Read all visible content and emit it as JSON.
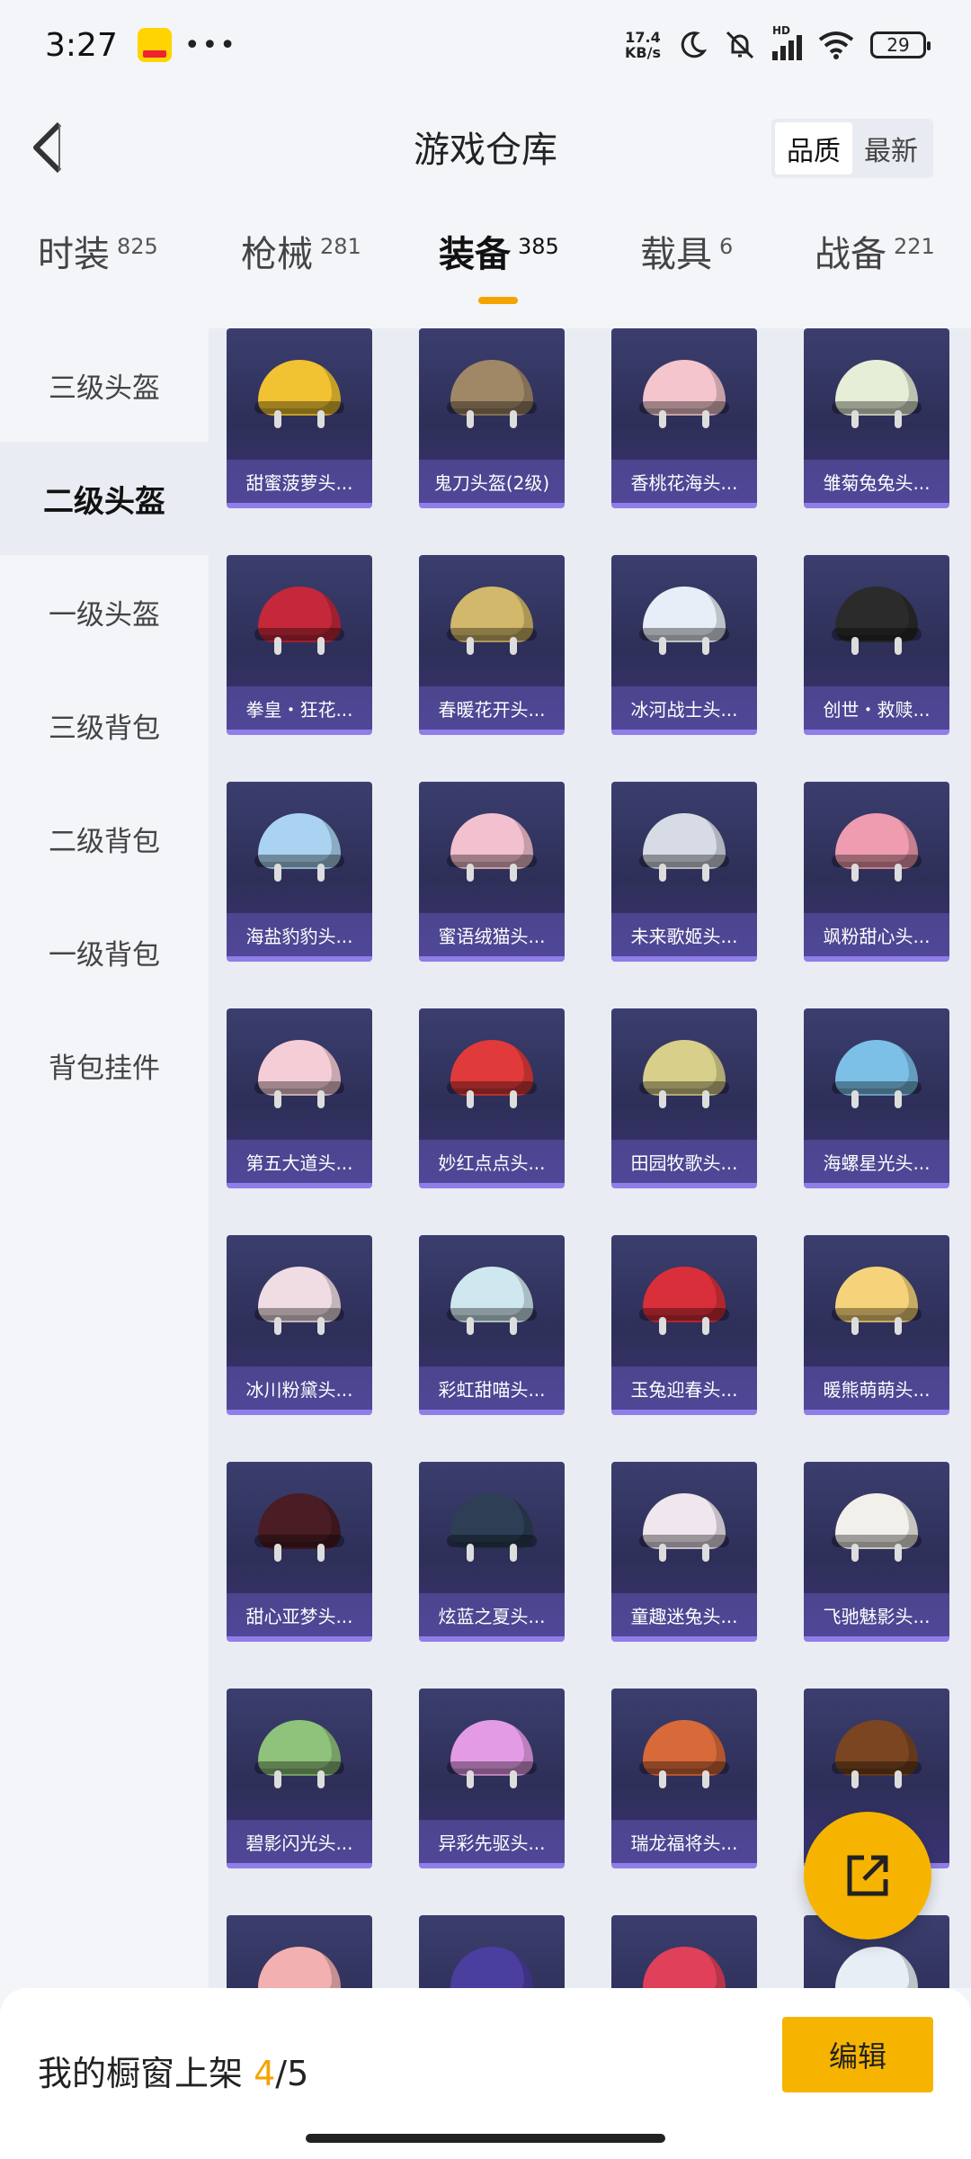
{
  "status_bar": {
    "time": "3:27",
    "dots": "•••",
    "net_speed_value": "17.4",
    "net_speed_unit": "KB/s",
    "network": "HD",
    "battery": "29"
  },
  "header": {
    "title": "游戏仓库",
    "sort_options": [
      "品质",
      "最新"
    ],
    "sort_selected": "品质"
  },
  "tabs": [
    {
      "label": "时装",
      "count": "825"
    },
    {
      "label": "枪械",
      "count": "281"
    },
    {
      "label": "装备",
      "count": "385",
      "active": true
    },
    {
      "label": "载具",
      "count": "6"
    },
    {
      "label": "战备",
      "count": "221"
    }
  ],
  "sidebar": [
    {
      "label": "三级头盔"
    },
    {
      "label": "二级头盔",
      "active": true
    },
    {
      "label": "一级头盔"
    },
    {
      "label": "三级背包"
    },
    {
      "label": "二级背包"
    },
    {
      "label": "一级背包"
    },
    {
      "label": "背包挂件"
    }
  ],
  "items": [
    {
      "name": "甜蜜菠萝头...",
      "color": "#f1c232"
    },
    {
      "name": "鬼刀头盔(2级)",
      "color": "#a08867"
    },
    {
      "name": "香桃花海头...",
      "color": "#f4c5cc"
    },
    {
      "name": "雏菊兔兔头...",
      "color": "#e6eed8"
    },
    {
      "name": "拳皇・狂花...",
      "color": "#c5283a"
    },
    {
      "name": "春暖花开头...",
      "color": "#d2b86a"
    },
    {
      "name": "冰河战士头...",
      "color": "#e8eef7"
    },
    {
      "name": "创世・救赎...",
      "color": "#2b2b2b"
    },
    {
      "name": "海盐豹豹头...",
      "color": "#a9d3f0"
    },
    {
      "name": "蜜语绒猫头...",
      "color": "#f3c0cf"
    },
    {
      "name": "未来歌姬头...",
      "color": "#d6dbe6"
    },
    {
      "name": "飒粉甜心头...",
      "color": "#ef9bb0"
    },
    {
      "name": "第五大道头...",
      "color": "#f5cdd6"
    },
    {
      "name": "妙红点点头...",
      "color": "#e03a3a"
    },
    {
      "name": "田园牧歌头...",
      "color": "#d8d08a"
    },
    {
      "name": "海螺星光头...",
      "color": "#7cc0e8"
    },
    {
      "name": "冰川粉黛头...",
      "color": "#f0dde3"
    },
    {
      "name": "彩虹甜喵头...",
      "color": "#cfe8f0"
    },
    {
      "name": "玉兔迎春头...",
      "color": "#d92f3a"
    },
    {
      "name": "暖熊萌萌头...",
      "color": "#f6d27a"
    },
    {
      "name": "甜心亚梦头...",
      "color": "#4a1c24"
    },
    {
      "name": "炫蓝之夏头...",
      "color": "#2d3e55"
    },
    {
      "name": "童趣迷兔头...",
      "color": "#f0e6ee"
    },
    {
      "name": "飞驰魅影头...",
      "color": "#f2f0ea"
    },
    {
      "name": "碧影闪光头...",
      "color": "#8fc27a"
    },
    {
      "name": "异彩先驱头...",
      "color": "#e39be6"
    },
    {
      "name": "瑞龙福将头...",
      "color": "#d86a3a"
    },
    {
      "name": "",
      "color": "#7a4520"
    },
    {
      "name": "",
      "color": "#f2b0b0"
    },
    {
      "name": "",
      "color": "#4a3e9e"
    },
    {
      "name": "",
      "color": "#e0405a"
    },
    {
      "name": "",
      "color": "#e8eef5"
    }
  ],
  "bottom_bar": {
    "label": "我的橱窗上架",
    "current": "4",
    "separator": "/",
    "total": "5",
    "edit_label": "编辑"
  },
  "accent_color": "#f6b400"
}
